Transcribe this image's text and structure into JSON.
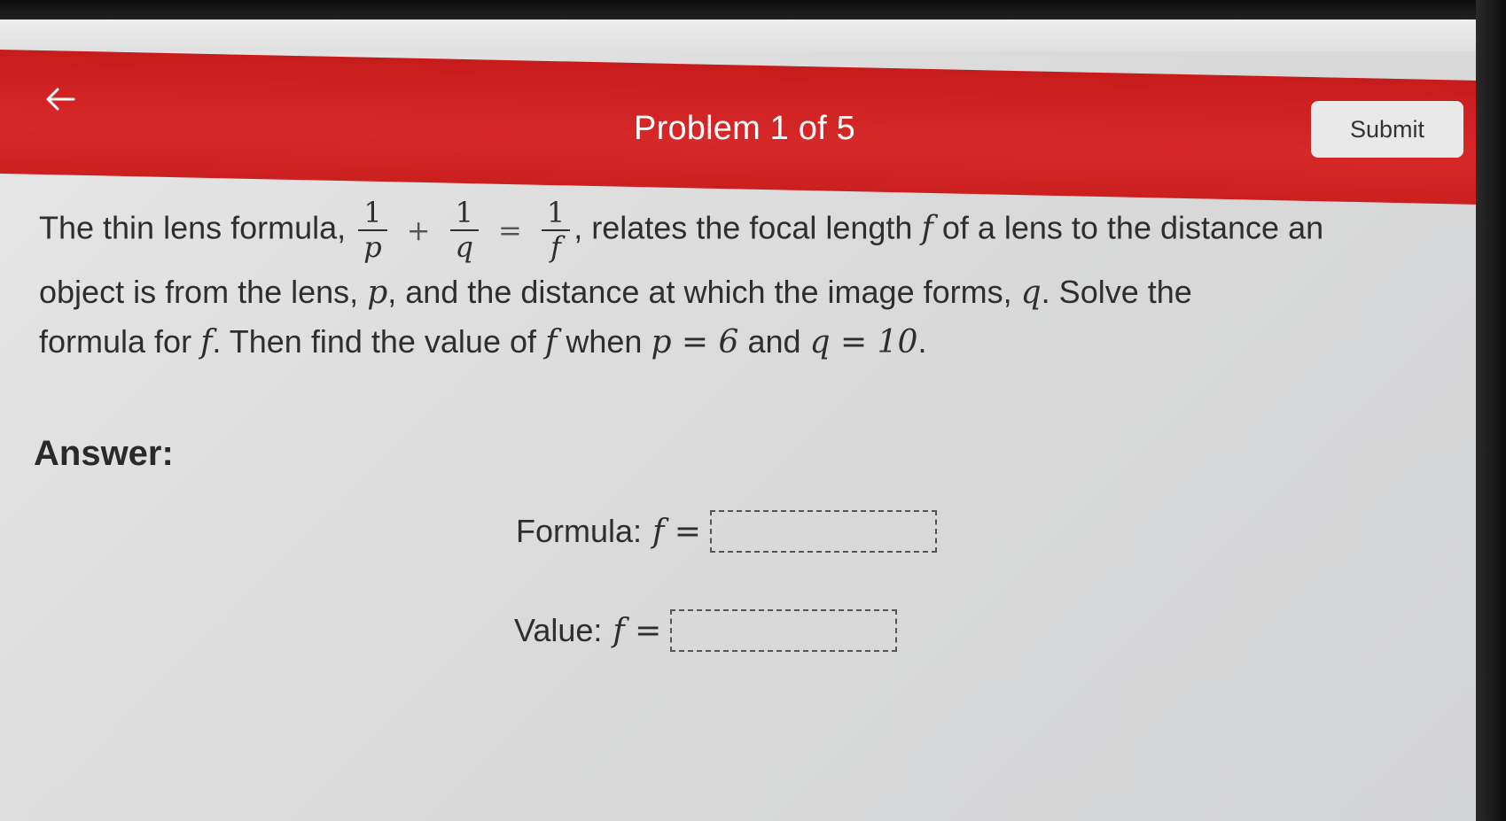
{
  "header": {
    "back_icon": "arrow-left-icon",
    "title": "Problem 1 of 5",
    "submit_label": "Submit"
  },
  "question": {
    "line1_prefix": "The thin lens formula,",
    "frac1_num": "1",
    "frac1_den": "p",
    "plus": "+",
    "frac2_num": "1",
    "frac2_den": "q",
    "equals": "=",
    "frac3_num": "1",
    "frac3_den": "f",
    "line1_suffix_a": ", relates the focal length",
    "var_f": "f",
    "line1_suffix_b": "of a lens to the distance an",
    "line2_a": "object is from the lens,",
    "var_p": "p",
    "line2_b": ", and the distance at which the image forms,",
    "var_q": "q",
    "line2_c": ". Solve the",
    "line3_a": "formula for",
    "line3_b": ". Then find the value of",
    "line3_c": "when",
    "p_value_expr": "p = 6",
    "line3_d": "and",
    "q_value_expr": "q = 10",
    "line3_end": "."
  },
  "answer": {
    "heading": "Answer:",
    "formula_label": "Formula:",
    "formula_lhs": "f =",
    "formula_value": "",
    "value_label": "Value:",
    "value_lhs": "f =",
    "value_value": ""
  }
}
